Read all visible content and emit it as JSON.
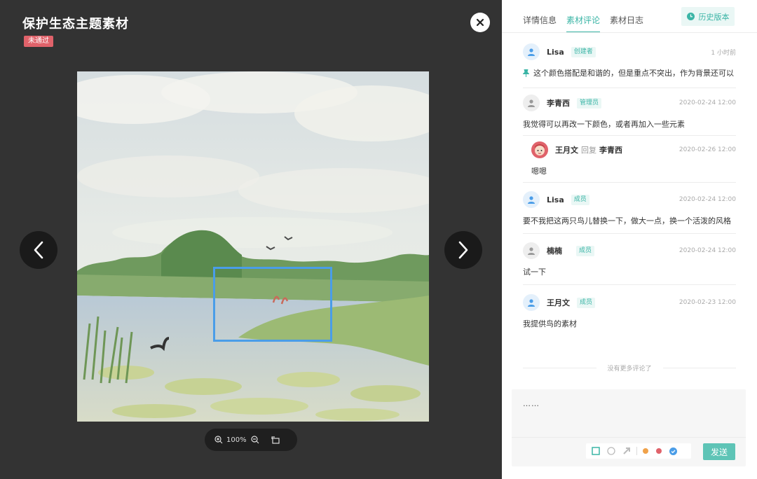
{
  "viewer": {
    "title": "保护生态主题素材",
    "status": "未通过",
    "zoom_level": "100%"
  },
  "tabs": [
    {
      "label": "详情信息",
      "active": false
    },
    {
      "label": "素材评论",
      "active": true
    },
    {
      "label": "素材日志",
      "active": false
    }
  ],
  "history_button": "历史版本",
  "comments": [
    {
      "name": "Lisa",
      "role": "创建者",
      "time": "1 小时前",
      "text": "这个颜色搭配是和谐的，但是重点不突出，作为背景还可以",
      "pinned": true
    },
    {
      "name": "李青西",
      "role": "管理员",
      "time": "2020-02-24 12:00",
      "text": "我觉得可以再改一下颜色，或者再加入一些元素"
    },
    {
      "name": "王月文",
      "reply_word": "回复",
      "reply_to": "李青西",
      "time": "2020-02-26 12:00",
      "text": "嗯嗯"
    },
    {
      "name": "Lisa",
      "role": "成员",
      "time": "2020-02-24 12:00",
      "text": "要不我把这两只鸟儿替换一下，做大一点，换一个活泼的风格"
    },
    {
      "name": "楠楠",
      "role": "成员",
      "time": "2020-02-24 12:00",
      "text": "试一下"
    },
    {
      "name": "王月文",
      "role": "成员",
      "time": "2020-02-23 12:00",
      "text": "我提供鸟的素材"
    }
  ],
  "no_more": "没有更多评论了",
  "editor": {
    "value": "……",
    "send_label": "发送",
    "colors": [
      "#f0a24a",
      "#e0626a",
      "#4a9de8"
    ]
  },
  "accent_color": "#3bb5a6"
}
